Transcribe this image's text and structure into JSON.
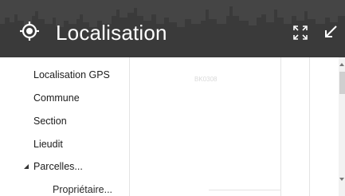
{
  "header": {
    "title": "Localisation",
    "icon": "crosshair-location-icon",
    "fullscreen_icon": "fullscreen-icon",
    "minimize_icon": "minimize-arrow-icon"
  },
  "map": {
    "parcel_label": "BK0308"
  },
  "menu": {
    "items": [
      {
        "label": "Localisation GPS"
      },
      {
        "label": "Commune"
      },
      {
        "label": "Section"
      },
      {
        "label": "Lieudit"
      },
      {
        "label": "Parcelles..."
      },
      {
        "label": "Propriétaire..."
      }
    ]
  },
  "colors": {
    "header_bg": "#454545",
    "title_text": "#ffffff",
    "menu_text": "#1c1c1c"
  }
}
